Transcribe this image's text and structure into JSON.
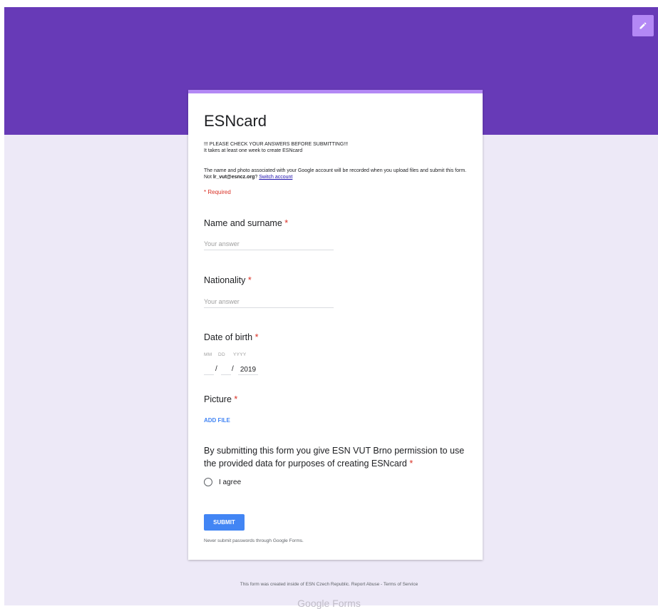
{
  "form": {
    "title": "ESNcard",
    "description_line1": "!!! PLEASE CHECK YOUR ANSWERS BEFORE SUBMITTING!!!",
    "description_line2": "It takes at least one week to create ESNcard",
    "notice_prefix": "The name and photo associated with your Google account will be recorded when you upload files and submit this form. Not ",
    "notice_email": "lr_vut@esncz.org",
    "notice_suffix": "? ",
    "switch_account_label": "Switch account",
    "required_label": "* Required"
  },
  "questions": {
    "name": {
      "label": "Name and surname",
      "star": "*",
      "placeholder": "Your answer"
    },
    "nationality": {
      "label": "Nationality",
      "star": "*",
      "placeholder": "Your answer"
    },
    "dob": {
      "label": "Date of birth",
      "star": "*",
      "mm_label": "MM",
      "dd_label": "DD",
      "yyyy_label": "YYYY",
      "slash": "/",
      "year_value": "2019"
    },
    "picture": {
      "label": "Picture",
      "star": "*",
      "add_file_label": "ADD FILE"
    },
    "consent": {
      "label": "By submitting this form you give ESN VUT Brno permission to use the provided data for purposes of creating ESNcard",
      "star": "*",
      "option_label": "I agree"
    }
  },
  "submit": {
    "label": "SUBMIT",
    "never_text": "Never submit passwords through Google Forms."
  },
  "footer": {
    "text": "This form was created inside of ESN Czech Republic. Report Abuse - Terms of Service",
    "logo_text": "Google Forms"
  },
  "colors": {
    "header": "#673ab7",
    "accent": "#b388f5",
    "button": "#4285f4",
    "required": "#d93025"
  }
}
